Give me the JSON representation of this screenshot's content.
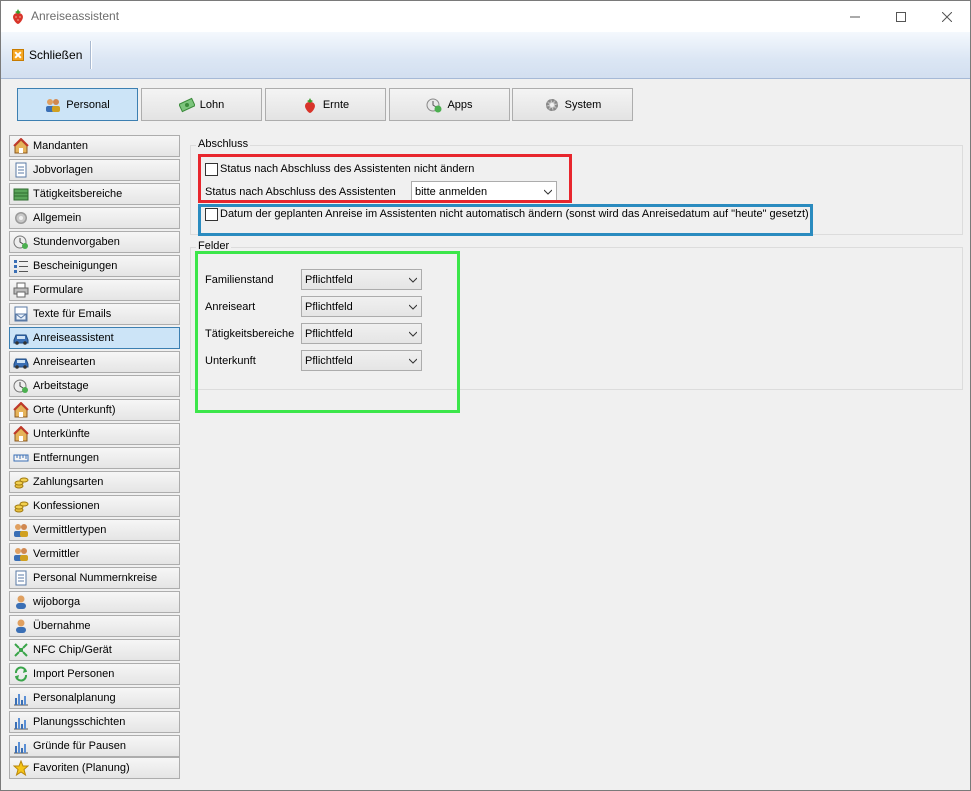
{
  "window": {
    "title": "Anreiseassistent",
    "controls": {
      "minimize": "—",
      "maximize": "☐",
      "close": "✕"
    }
  },
  "toolbar": {
    "close_label": "Schließen"
  },
  "tabs": [
    {
      "label": "Personal",
      "icon": "people-icon",
      "active": true
    },
    {
      "label": "Lohn",
      "icon": "money-icon",
      "active": false
    },
    {
      "label": "Ernte",
      "icon": "strawberry-icon",
      "active": false
    },
    {
      "label": "Apps",
      "icon": "apps-icon",
      "active": false
    },
    {
      "label": "System",
      "icon": "gear-icon",
      "active": false
    }
  ],
  "sidebar": {
    "items": [
      {
        "label": "Mandanten",
        "icon": "house-icon"
      },
      {
        "label": "Jobvorlagen",
        "icon": "document-icon"
      },
      {
        "label": "Tätigkeitsbereiche",
        "icon": "field-icon"
      },
      {
        "label": "Allgemein",
        "icon": "gear-icon"
      },
      {
        "label": "Stundenvorgaben",
        "icon": "clock-icon"
      },
      {
        "label": "Bescheinigungen",
        "icon": "list-icon"
      },
      {
        "label": "Formulare",
        "icon": "printer-icon"
      },
      {
        "label": "Texte für Emails",
        "icon": "envelope-icon"
      },
      {
        "label": "Anreiseassistent",
        "icon": "car-icon",
        "active": true
      },
      {
        "label": "Anreisearten",
        "icon": "car-icon"
      },
      {
        "label": "Arbeitstage",
        "icon": "clock-icon"
      },
      {
        "label": "Orte (Unterkunft)",
        "icon": "house-icon"
      },
      {
        "label": "Unterkünfte",
        "icon": "house-icon"
      },
      {
        "label": "Entfernungen",
        "icon": "ruler-icon"
      },
      {
        "label": "Zahlungsarten",
        "icon": "coins-icon"
      },
      {
        "label": "Konfessionen",
        "icon": "coins-icon"
      },
      {
        "label": "Vermittlertypen",
        "icon": "people-icon"
      },
      {
        "label": "Vermittler",
        "icon": "people-icon"
      },
      {
        "label": "Personal Nummernkreise",
        "icon": "document-icon"
      },
      {
        "label": "wijoborga",
        "icon": "person-icon"
      },
      {
        "label": "Übernahme",
        "icon": "person-icon"
      },
      {
        "label": "NFC Chip/Gerät",
        "icon": "nfc-icon"
      },
      {
        "label": "Import Personen",
        "icon": "refresh-icon"
      },
      {
        "label": "Personalplanung",
        "icon": "bar-chart-icon"
      },
      {
        "label": "Planungsschichten",
        "icon": "bar-chart-icon"
      },
      {
        "label": "Gründe für Pausen",
        "icon": "bar-chart-icon"
      },
      {
        "label": "Favoriten (Planung)",
        "icon": "star-icon"
      }
    ]
  },
  "abschluss": {
    "group_label": "Abschluss",
    "status_no_change_label": "Status nach Abschluss des Assistenten nicht ändern",
    "status_label": "Status nach Abschluss des Assistenten",
    "status_value": "bitte anmelden",
    "date_no_auto_label": "Datum der geplanten Anreise im Assistenten nicht automatisch ändern (sonst wird das Anreisedatum auf \"heute\" gesetzt)"
  },
  "felder": {
    "group_label": "Felder",
    "rows": [
      {
        "label": "Familienstand",
        "value": "Pflichtfeld"
      },
      {
        "label": "Anreiseart",
        "value": "Pflichtfeld"
      },
      {
        "label": "Tätigkeitsbereiche",
        "value": "Pflichtfeld"
      },
      {
        "label": "Unterkunft",
        "value": "Pflichtfeld"
      }
    ]
  },
  "colors": {
    "highlight_red": "#e8262d",
    "highlight_blue": "#2a8bbf",
    "highlight_green": "#3ce64a",
    "active_tab_bg": "#cce4f7"
  }
}
